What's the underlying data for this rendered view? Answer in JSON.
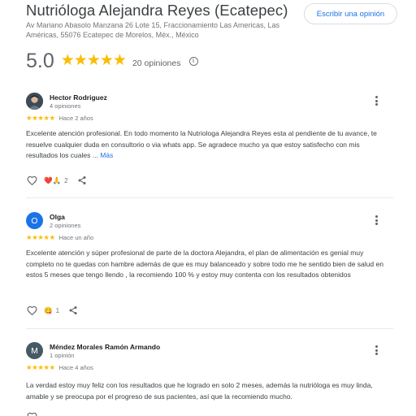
{
  "header": {
    "title": "Nutrióloga Alejandra Reyes (Ecatepec)",
    "write_review_label": "Escribir una opinión",
    "address": "Av Mariano Abasolo Manzana 26 Lote 15, Fraccionamiento Las Americas, Las Américas, 55076 Ecatepec de Morelos, Méx., México"
  },
  "rating": {
    "score": "5.0",
    "stars": 5,
    "stars_text": "★★★★★",
    "count_label": "20 opiniones",
    "info_glyph": "i"
  },
  "reviews": [
    {
      "name": "Hector Rodriguez",
      "meta": "4 opiniones",
      "stars_text": "★★★★★",
      "rating": 5,
      "date": "Hace 2 años",
      "text": "Excelente atención profesional. En todo momento la Nutriologa Alejandra Reyes esta al pendiente de tu avance, te resuelve cualquier duda en consultorio o via whats app. Se agradece mucho ya que estoy satisfecho con mis resultados los cuales ...",
      "more_label": "Más",
      "reactions": "❤️🙏",
      "reaction_count": "2"
    },
    {
      "name": "Olga",
      "meta": "2 opiniones",
      "avatar_letter": "O",
      "avatar_color": "#1a73e8",
      "stars_text": "★★★★★",
      "rating": 5,
      "date": "Hace un año",
      "text": "Excelente atención y súper profesional de parte de la doctora Alejandra, el plan de alimentación es genial muy completo no te quedas con hambre además de que es muy balanceado y sobre todo me he sentido bien de salud en estos 5 meses que tengo llendo , la recomiendo 100 % y estoy muy contenta con los resultados obtenidos",
      "reactions": "😋",
      "reaction_count": "1"
    },
    {
      "name": "Méndez Morales Ramón Armando",
      "meta": "1 opinión",
      "avatar_letter": "M",
      "avatar_color": "#455a64",
      "stars_text": "★★★★★",
      "rating": 5,
      "date": "Hace 4 años",
      "text": "La verdad estoy muy feliz con los resultados que he logrado en solo 2 meses, además la nutrióloga es muy linda, amable y se preocupa por el progreso de sus pacientes, así que la recomiendo mucho."
    }
  ],
  "colors": {
    "accent": "#1a73e8",
    "star": "#fbbc04",
    "secondary_text": "#70757a"
  },
  "icons": [
    "info-icon",
    "more-vert-icon",
    "heart-icon",
    "share-icon"
  ]
}
